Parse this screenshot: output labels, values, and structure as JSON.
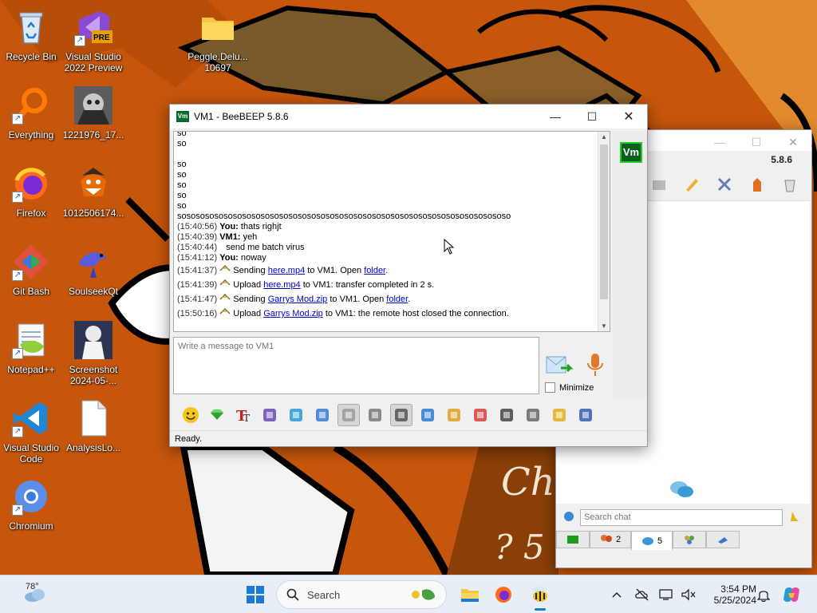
{
  "desktop": {
    "icons": [
      {
        "label": "Recycle Bin"
      },
      {
        "label": "Visual Studio 2022 Preview",
        "badge": "PRE"
      },
      {
        "label": "Peggle.Delu... 10697"
      },
      {
        "label": "Everything"
      },
      {
        "label": "1221976_17..."
      },
      {
        "label": "Firefox"
      },
      {
        "label": "1012506174..."
      },
      {
        "label": "Git Bash"
      },
      {
        "label": "SoulseekQt"
      },
      {
        "label": "Notepad++"
      },
      {
        "label": "Screenshot 2024-05-..."
      },
      {
        "label": "Visual Studio Code"
      },
      {
        "label": "AnalysisLo..."
      },
      {
        "label": "Chromium"
      }
    ]
  },
  "chat_window": {
    "title": "VM1 - BeeBEEP 5.8.6",
    "app_icon_text": "Vm",
    "avatar_text": "Vm",
    "messages": [
      {
        "text": "so"
      },
      {
        "text": "so"
      },
      {
        "text": ""
      },
      {
        "text": "so"
      },
      {
        "text": "so"
      },
      {
        "text": "so"
      },
      {
        "text": "so"
      },
      {
        "text": "so"
      },
      {
        "text": "sosososososososososososososososososososososososososososososososososososo"
      },
      {
        "time": "(15:40:56)",
        "sender": "You:",
        "text": "thats righjt"
      },
      {
        "time": "(15:40:39)",
        "sender": "VM1:",
        "text": "yeh"
      },
      {
        "time": "(15:40:44)",
        "sender": "",
        "text": "send me batch virus"
      },
      {
        "time": "(15:41:12)",
        "sender": "You:",
        "text": "noway"
      }
    ],
    "transfers": [
      {
        "time": "(15:41:37)",
        "action": "Sending",
        "file": "here.mp4",
        "mid": "to VM1. Open",
        "link2": "folder",
        "end": "."
      },
      {
        "time": "(15:41:39)",
        "action": "Upload",
        "file": "here.mp4",
        "mid": "to VM1: transfer completed in 2 s.",
        "link2": "",
        "end": ""
      },
      {
        "time": "(15:41:47)",
        "action": "Sending",
        "file": "Garrys Mod.zip",
        "mid": "to VM1. Open",
        "link2": "folder",
        "end": "."
      },
      {
        "time": "(15:50:16)",
        "action": "Upload",
        "file": "Garrys Mod.zip",
        "mid": "to VM1: the remote host closed the connection.",
        "link2": "",
        "end": ""
      }
    ],
    "input_placeholder": "Write a message to VM1",
    "minimize_label": "Minimize",
    "status": "Ready.",
    "toolbar_icons": [
      "smiley-icon",
      "green-gem-icon",
      "text-format-icon",
      "color-picker-icon",
      "filter-icon",
      "settings-gear-icon",
      "spell-check-icon",
      "screenshot-icon",
      "music-note-icon",
      "send-file-icon",
      "send-folder-icon",
      "code-icon",
      "webcam-icon",
      "keyboard-icon",
      "notepad-icon",
      "save-chat-icon"
    ]
  },
  "main_window": {
    "version": "5.8.6",
    "search_placeholder": "Search chat",
    "tabs": [
      {
        "icon": "green-user-icon",
        "count": ""
      },
      {
        "icon": "users-icon",
        "count": "2"
      },
      {
        "icon": "chat-icon",
        "count": "5"
      },
      {
        "icon": "group-icon",
        "count": ""
      },
      {
        "icon": "share-icon",
        "count": ""
      }
    ]
  },
  "taskbar": {
    "weather_temp": "78°",
    "search_label": "Search",
    "time": "3:54 PM",
    "date": "5/25/2024"
  }
}
